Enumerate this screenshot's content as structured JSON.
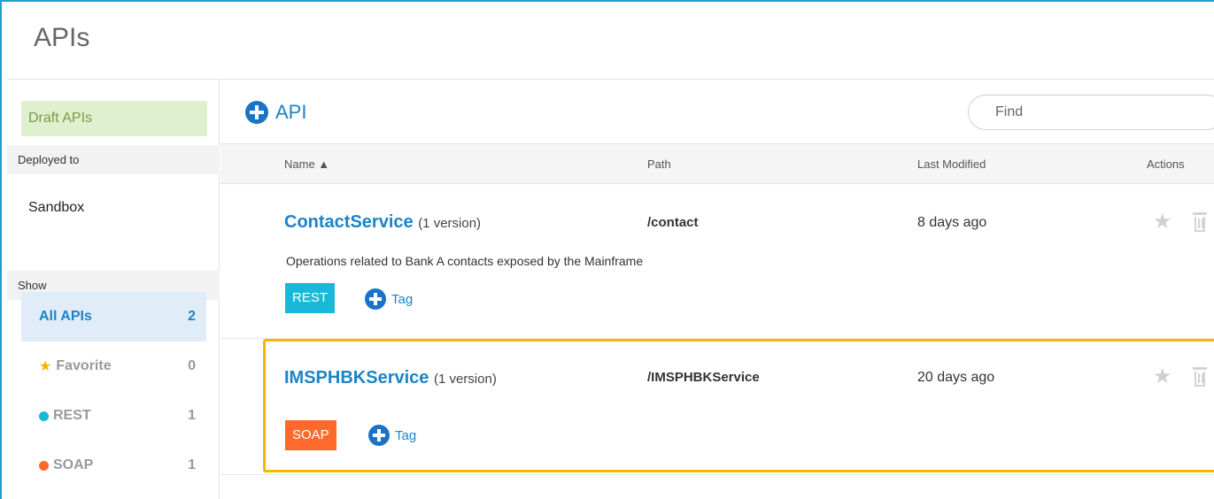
{
  "page": {
    "title": "APIs"
  },
  "colors": {
    "frame": "#1aa3c8",
    "accent_blue": "#1b84c9",
    "rest": "#1ab8d8",
    "soap": "#ff6a2c",
    "highlight": "#f5b800",
    "draft_bg": "#dff0cf"
  },
  "sidebar": {
    "draft_label": "Draft APIs",
    "deployed_heading": "Deployed to",
    "deployed_target": "Sandbox",
    "show_heading": "Show",
    "filters": [
      {
        "label": "All APIs",
        "count": "2",
        "icon": "none",
        "active": true
      },
      {
        "label": "Favorite",
        "count": "0",
        "icon": "star-icon",
        "active": false
      },
      {
        "label": "REST",
        "count": "1",
        "icon": "rest-dot-icon",
        "active": false
      },
      {
        "label": "SOAP",
        "count": "1",
        "icon": "soap-dot-icon",
        "active": false
      }
    ]
  },
  "toolbar": {
    "add_label": "API",
    "add_icon": "plus-circle-icon",
    "find_placeholder": "Find"
  },
  "table": {
    "columns": {
      "name": "Name ▲",
      "path": "Path",
      "modified": "Last Modified",
      "actions": "Actions"
    },
    "rows": [
      {
        "name": "ContactService",
        "version": "(1 version)",
        "path": "/contact",
        "modified": "8 days ago",
        "description": "Operations related to Bank A contacts exposed by the Mainframe",
        "type": "REST",
        "tag_label": "Tag"
      },
      {
        "name": "IMSPHBKService",
        "version": "(1 version)",
        "path": "/IMSPHBKService",
        "modified": "20 days ago",
        "description": "",
        "type": "SOAP",
        "tag_label": "Tag"
      }
    ]
  },
  "actions": {
    "star_glyph": "★"
  }
}
